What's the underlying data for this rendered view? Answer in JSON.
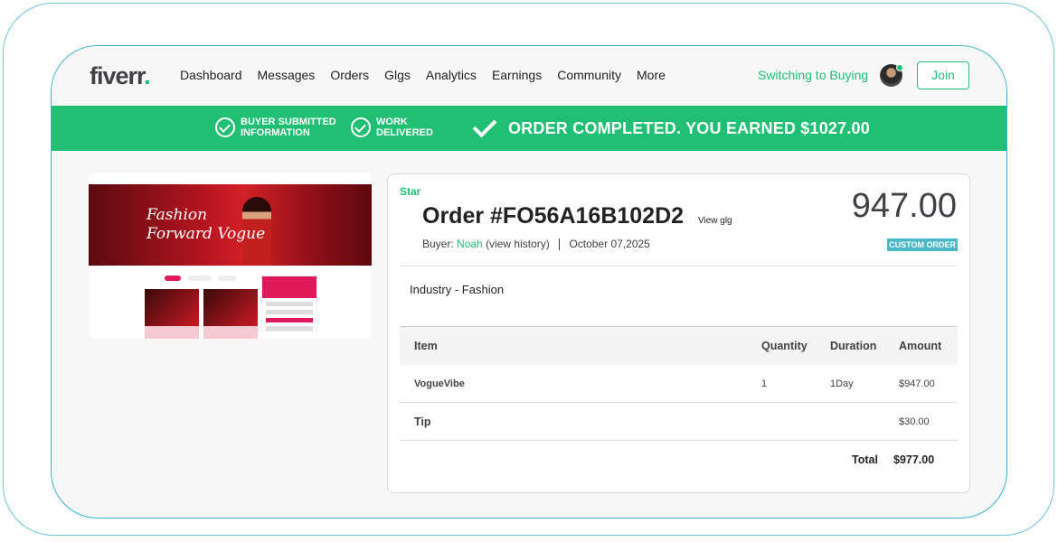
{
  "brand": {
    "name": "fiverr",
    "dot": "."
  },
  "nav": {
    "links": [
      "Dashboard",
      "Messages",
      "Orders",
      "Glgs",
      "Analytics",
      "Earnings",
      "Community",
      "More"
    ],
    "switch_label": "Switching to Buying",
    "join_label": "Join"
  },
  "banner": {
    "step1": "BUYER SUBMITTED INFORMATION",
    "step2": "WORK DELIVERED",
    "completed": "ORDER COMPLETED. YOU EARNED $1027.00"
  },
  "thumbnail": {
    "hero_title_line1": "Fashion",
    "hero_title_line2": "Forward Vogue"
  },
  "order": {
    "level": "Star",
    "title": "Order #FO56A16B102D2",
    "view_gig": "View glg",
    "buyer_prefix": "Buyer:",
    "buyer_name": "Noah",
    "view_history": "(view history)",
    "date": "October 07,2025",
    "price": "947.00",
    "badge": "CUSTOM ORDER",
    "industry": "Industry - Fashion"
  },
  "table": {
    "headers": {
      "item": "Item",
      "quantity": "Quantity",
      "duration": "Duration",
      "amount": "Amount"
    },
    "rows": [
      {
        "item": "VogueVibe",
        "quantity": "1",
        "duration": "1Day",
        "amount": "$947.00"
      }
    ],
    "tip": {
      "label": "Tip",
      "amount": "$30.00"
    },
    "total": {
      "label": "Total",
      "amount": "$977.00"
    }
  },
  "colors": {
    "accent": "#1dbf73",
    "badge": "#4bb8c7"
  }
}
